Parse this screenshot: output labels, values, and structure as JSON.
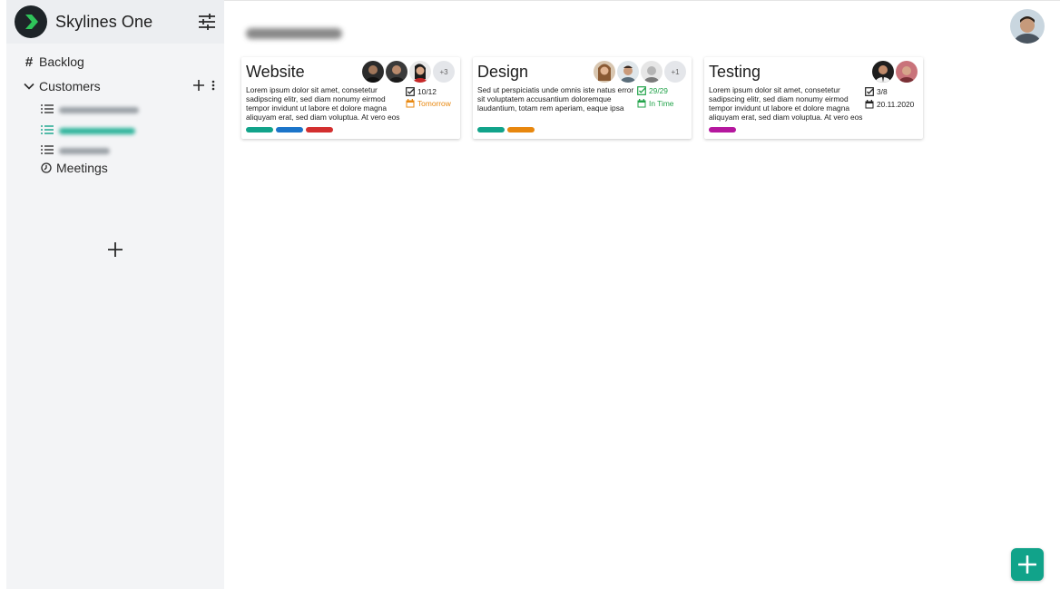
{
  "app": {
    "name": "Skylines One"
  },
  "sidebar": {
    "backlog": "Backlog",
    "customers": "Customers",
    "meetings": "Meetings",
    "sub_items": [
      {
        "color": "#9aa0a6",
        "width": 88
      },
      {
        "color": "#2bb39a",
        "width": 84
      },
      {
        "color": "#9aa0a6",
        "width": 56
      }
    ]
  },
  "projects": [
    {
      "title": "Website",
      "description": "Lorem ipsum dolor sit amet, consetetur sadipscing elitr, sed diam nonumy eirmod tempor invidunt ut labore et dolore magna aliquyam erat, sed diam voluptua. At vero eos",
      "tasks": "10/12",
      "due": "Tomorrow",
      "due_color": "#e8870e",
      "more_members": "+3",
      "tag_colors": [
        "#11a38a",
        "#1b74c9",
        "#d32f2f"
      ]
    },
    {
      "title": "Design",
      "description": "Sed ut perspiciatis unde omnis iste natus error sit voluptatem accusantium doloremque laudantium, totam rem aperiam, eaque ipsa",
      "tasks": "29/29",
      "due": "In Time",
      "due_color": "#22a34a",
      "more_members": "+1",
      "tag_colors": [
        "#11a38a",
        "#e8870e"
      ]
    },
    {
      "title": "Testing",
      "description": "Lorem ipsum dolor sit amet, consetetur sadipscing elitr, sed diam nonumy eirmod tempor invidunt ut labore et dolore magna aliquyam erat, sed diam voluptua. At vero eos",
      "tasks": "3/8",
      "due": "20.11.2020",
      "due_color": "#222222",
      "more_members": "",
      "tag_colors": [
        "#b5179e"
      ]
    }
  ],
  "colors": {
    "accent": "#11a38a",
    "sidebar_bg": "#f3f4f6"
  }
}
